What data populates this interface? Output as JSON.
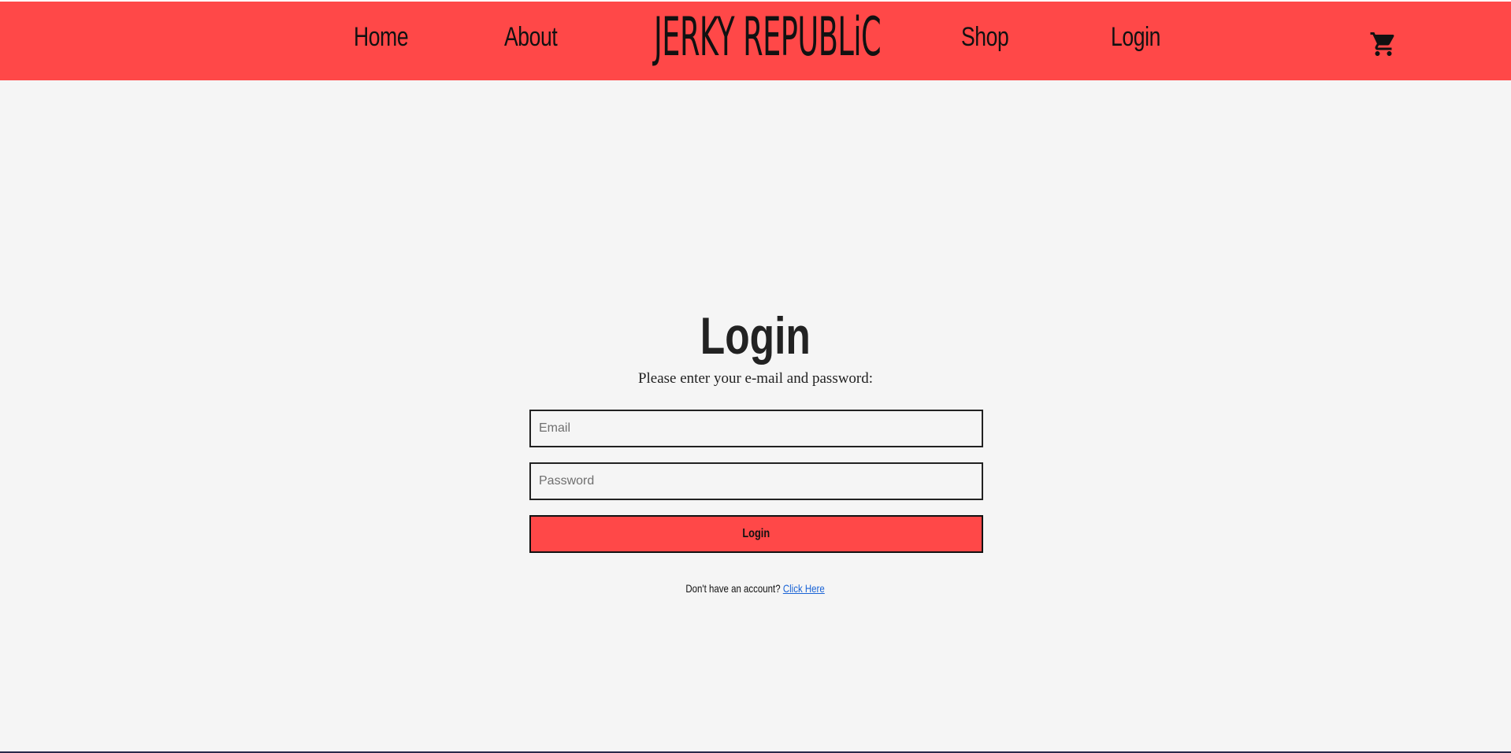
{
  "nav": {
    "home": "Home",
    "about": "About",
    "logo": "JERKY REPUBLiC",
    "shop": "Shop",
    "login": "Login",
    "cart_icon": "shopping-cart-icon"
  },
  "login": {
    "title": "Login",
    "subtitle": "Please enter your e-mail and password:",
    "email_placeholder": "Email",
    "password_placeholder": "Password",
    "button_label": "Login",
    "signup_prompt": "Don't have an account?",
    "signup_link": "Click Here"
  },
  "colors": {
    "brand_red": "#ff4848",
    "background": "#f5f5f5",
    "link_blue": "#1a64d6"
  }
}
